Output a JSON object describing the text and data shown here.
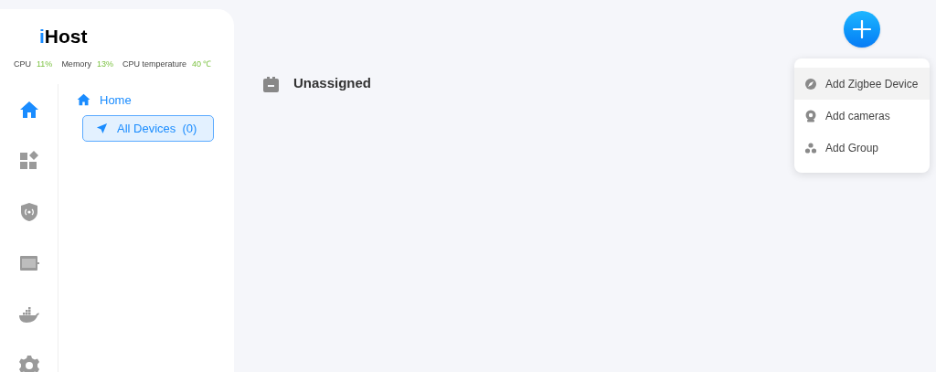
{
  "brand": {
    "accent": "i",
    "rest": "Host"
  },
  "stats": [
    {
      "label": "CPU",
      "value": "11%"
    },
    {
      "label": "Memory",
      "value": "13%"
    },
    {
      "label": "CPU temperature",
      "value": "40 ℃"
    }
  ],
  "nav_rail": [
    {
      "kind": "home",
      "selected": true
    },
    {
      "kind": "apps",
      "selected": false
    },
    {
      "kind": "security",
      "selected": false
    },
    {
      "kind": "cast",
      "selected": false
    },
    {
      "kind": "docker",
      "selected": false
    },
    {
      "kind": "settings",
      "selected": false
    }
  ],
  "tree": [
    {
      "label": "Home",
      "selected": false,
      "children": [
        {
          "label": "All Devices",
          "count": "(0)",
          "selected": true
        }
      ]
    }
  ],
  "group": {
    "label": "Unassigned"
  },
  "add_menu": {
    "items": [
      {
        "kind": "zigbee",
        "label": "Add Zigbee Device",
        "selected": true
      },
      {
        "kind": "camera",
        "label": "Add cameras",
        "selected": false
      },
      {
        "kind": "group",
        "label": "Add Group",
        "selected": false
      }
    ]
  }
}
